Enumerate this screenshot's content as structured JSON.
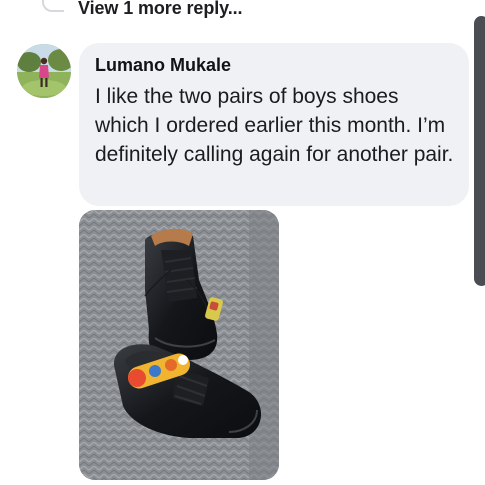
{
  "thread": {
    "view_more_label": "View 1 more reply..."
  },
  "comment": {
    "author": "Lumano Mukale",
    "text": "I like the two pairs of boys shoes which I ordered earlier this month. I’m definitely calling again for another pair."
  },
  "attachment": {
    "subject": "photo of two pairs of black school shoes with tags"
  },
  "colors": {
    "bubble_bg": "#eff1f4",
    "text": "#1a1c1f",
    "scrollbar": "#4a4d52"
  }
}
